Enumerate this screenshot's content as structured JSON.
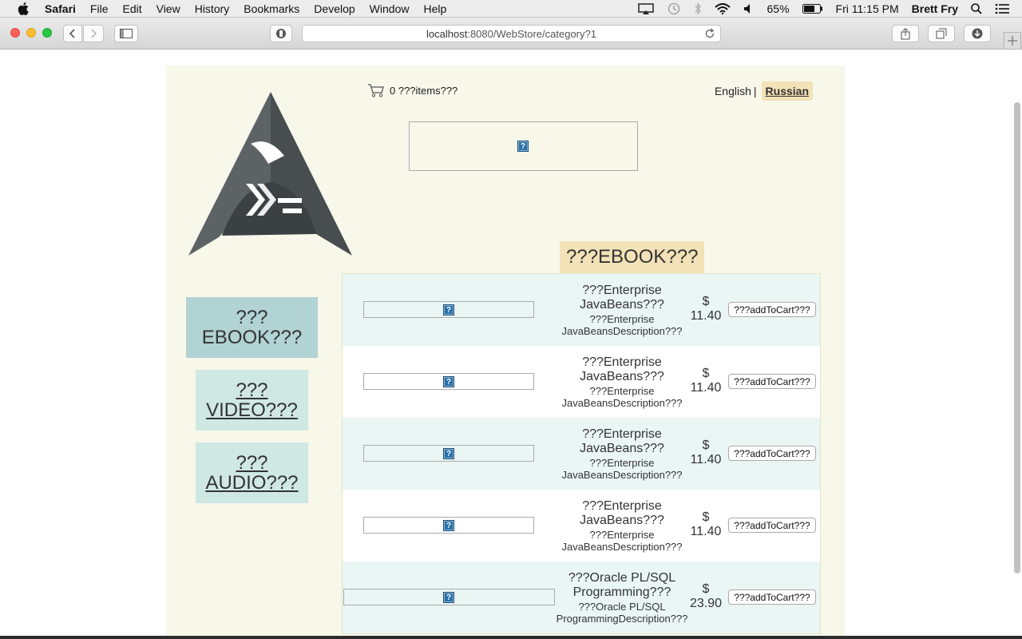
{
  "menubar": {
    "app_name": "Safari",
    "items": [
      "File",
      "Edit",
      "View",
      "History",
      "Bookmarks",
      "Develop",
      "Window",
      "Help"
    ],
    "battery": "65%",
    "clock": "Fri 11:15 PM",
    "user": "Brett Fry"
  },
  "browser": {
    "url_host": "localhost",
    "url_path": ":8080/WebStore/category?1"
  },
  "header": {
    "cart_text": "0 ???items???",
    "lang_english": "English",
    "lang_separator": "|",
    "lang_russian": "Russian"
  },
  "banner": {
    "icon_text": "?"
  },
  "category_title": "???EBOOK???",
  "sidebar": {
    "ebook": "??? EBOOK???",
    "video": "??? VIDEO???",
    "audio": "??? AUDIO???"
  },
  "products": [
    {
      "name": "???Enterprise JavaBeans???",
      "description": "???Enterprise JavaBeansDescription???",
      "currency": "$",
      "price": "11.40",
      "button": "???addToCart???",
      "image_icon": "?"
    },
    {
      "name": "???Enterprise JavaBeans???",
      "description": "???Enterprise JavaBeansDescription???",
      "currency": "$",
      "price": "11.40",
      "button": "???addToCart???",
      "image_icon": "?"
    },
    {
      "name": "???Enterprise JavaBeans???",
      "description": "???Enterprise JavaBeansDescription???",
      "currency": "$",
      "price": "11.40",
      "button": "???addToCart???",
      "image_icon": "?"
    },
    {
      "name": "???Enterprise JavaBeans???",
      "description": "???Enterprise JavaBeansDescription???",
      "currency": "$",
      "price": "11.40",
      "button": "???addToCart???",
      "image_icon": "?"
    },
    {
      "name": "???Oracle PL/SQL Programming???",
      "description": "???Oracle PL/SQL ProgrammingDescription???",
      "currency": "$",
      "price": "23.90",
      "button": "???addToCart???",
      "image_icon": "?"
    }
  ],
  "colors": {
    "page_bg": "#f7f7ea",
    "category_highlight": "#f3e2b7",
    "sidebar_active": "#b1d3d4",
    "sidebar_inactive": "#cfe8e4",
    "row_alt": "#eaf6f4"
  }
}
